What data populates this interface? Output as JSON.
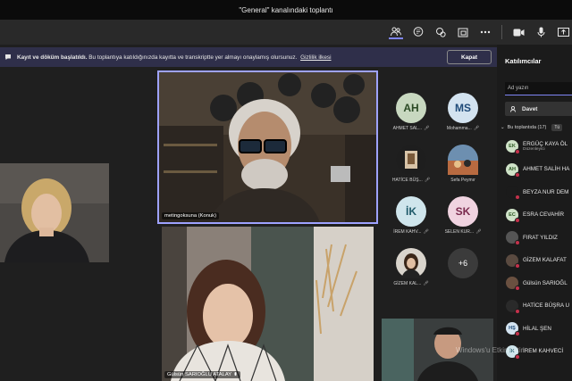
{
  "window": {
    "title": "\"General\" kanalındaki toplantı"
  },
  "toolbar": {
    "icons": [
      "people-icon",
      "chat-icon",
      "reactions-icon",
      "rooms-icon",
      "more-icon",
      "camera-icon",
      "mic-icon",
      "share-icon"
    ]
  },
  "banner": {
    "title": "Kayıt ve döküm başlatıldı.",
    "text": "Bu toplantıya katıldığınızda kayıtta ve transkriptte yer almayı onaylamış olursunuz.",
    "link": "Gizlilik ilkesi",
    "close_label": "Kapat"
  },
  "stage": {
    "featured_name": "metingoksuna (Konuk)",
    "bottom_center_name": "Gülsün SARIOĞLU ATALAY"
  },
  "gallery": [
    {
      "initials": "AH",
      "name": "AHMET SAL...",
      "color": "#c8d8c0",
      "text_color": "#2b4a25"
    },
    {
      "initials": "MS",
      "name": "Mohamma...",
      "color": "#d3e3f0",
      "text_color": "#1e4a78"
    },
    {
      "initials": "",
      "name": "HATİCE BÜŞ...",
      "color": "#2a2a2a",
      "text_color": "#fff"
    },
    {
      "initials": "",
      "name": "Sefa Peymır",
      "color": "#4a6a8a",
      "text_color": "#fff"
    },
    {
      "initials": "İK",
      "name": "İREM KAHV...",
      "color": "#cfe5ec",
      "text_color": "#1f5a6a"
    },
    {
      "initials": "SK",
      "name": "SELEN KUR...",
      "color": "#f0d3e0",
      "text_color": "#7a2a4e"
    },
    {
      "initials": "",
      "name": "GİZEM KAL...",
      "color": "#3a3a3a",
      "text_color": "#fff"
    },
    {
      "initials": "+6",
      "name": "",
      "color": "#3b3b3b",
      "text_color": "#fff"
    }
  ],
  "panel": {
    "title": "Katılımcılar",
    "search_placeholder": "Ad yazın",
    "invite_label": "Davet",
    "section_label": "Bu toplantıda (17)",
    "section_button": "Tü",
    "participants": [
      {
        "initials": "EK",
        "name": "ERGÜÇ KAYA ÖL",
        "role": "Düzenleyici",
        "color": "#cfe3c8",
        "text_color": "#2d5a24"
      },
      {
        "initials": "AH",
        "name": "AHMET SALİH HA",
        "role": "",
        "color": "#cfe3c8",
        "text_color": "#2d5a24"
      },
      {
        "initials": "",
        "name": "BEYZA NUR DEM",
        "role": "",
        "color": "#1b1b1b",
        "text_color": "#fff"
      },
      {
        "initials": "EC",
        "name": "ESRA CEVAHİR",
        "role": "",
        "color": "#cfe3c8",
        "text_color": "#2d5a24"
      },
      {
        "initials": "",
        "name": "FIRAT YILDIZ",
        "role": "",
        "color": "#555555",
        "text_color": "#fff"
      },
      {
        "initials": "",
        "name": "GİZEM KALAFAT",
        "role": "",
        "color": "#5a4a40",
        "text_color": "#fff"
      },
      {
        "initials": "",
        "name": "Gülsün SARIOĞL",
        "role": "",
        "color": "#6a5040",
        "text_color": "#fff"
      },
      {
        "initials": "",
        "name": "HATİCE BÜŞRA U",
        "role": "",
        "color": "#2a2a2a",
        "text_color": "#fff"
      },
      {
        "initials": "HŞ",
        "name": "HİLAL ŞEN",
        "role": "",
        "color": "#d3e3f0",
        "text_color": "#1e4a78"
      },
      {
        "initials": "İK",
        "name": "İREM KAHVECİ",
        "role": "",
        "color": "#cfe5ec",
        "text_color": "#1f5a6a"
      }
    ]
  },
  "watermark": "Windows'u Etkinleştir"
}
